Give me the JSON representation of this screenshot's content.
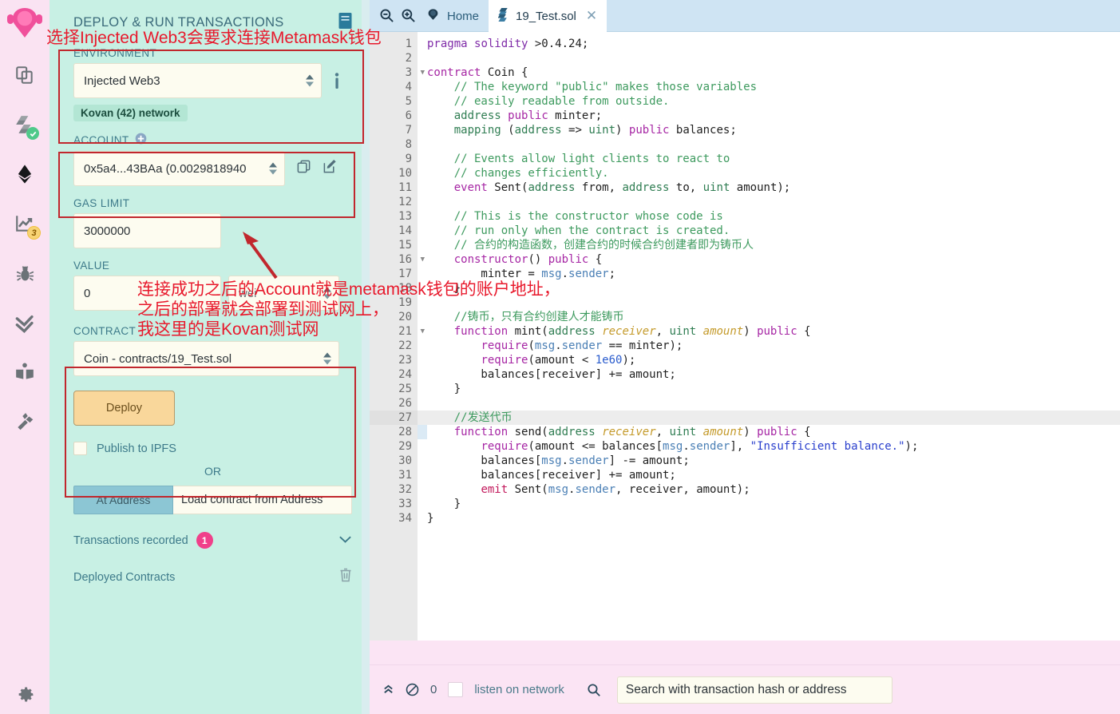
{
  "rail": {
    "logo_name": "remix-logo",
    "items": [
      {
        "name": "file-explorers",
        "icon": "files-icon",
        "badge": null
      },
      {
        "name": "solidity-compiler",
        "icon": "solidity-icon",
        "badge": "check"
      },
      {
        "name": "deploy-and-run-transactions",
        "icon": "ethereum-icon",
        "badge": null
      },
      {
        "name": "solidity-static-analysis",
        "icon": "chart-icon",
        "badge": "3"
      },
      {
        "name": "debugger",
        "icon": "bug-icon",
        "badge": null
      },
      {
        "name": "solidity-unit-testing",
        "icon": "double-check-icon",
        "badge": null
      },
      {
        "name": "remix-documentation",
        "icon": "book-icon",
        "badge": null
      },
      {
        "name": "plugin-manager",
        "icon": "plug-icon",
        "badge": null
      }
    ],
    "settings_icon": "gear-icon"
  },
  "panel": {
    "title": "DEPLOY & RUN TRANSACTIONS",
    "head_icon": "book-icon",
    "environment": {
      "label": "ENVIRONMENT",
      "value": "Injected Web3",
      "info_icon": "info-icon",
      "network_badge": "Kovan (42) network"
    },
    "account": {
      "label": "ACCOUNT",
      "add_icon": "plus-circle-icon",
      "value": "0x5a4...43BAa (0.0029818940",
      "copy_icon": "copy-icon",
      "edit_icon": "edit-icon"
    },
    "gas_limit": {
      "label": "GAS LIMIT",
      "value": "3000000"
    },
    "value_field": {
      "label": "VALUE",
      "value": "0",
      "unit": "wei"
    },
    "contract": {
      "label": "CONTRACT",
      "value": "Coin - contracts/19_Test.sol",
      "deploy_label": "Deploy"
    },
    "publish_ipfs": "Publish to IPFS",
    "or_text": "OR",
    "at_address": {
      "button": "At Address",
      "placeholder": "Load contract from Address"
    },
    "transactions_recorded": {
      "label": "Transactions recorded",
      "count": "1",
      "chevron": "chevron-down-icon"
    },
    "deployed_contracts": {
      "label": "Deployed Contracts",
      "trash_icon": "trash-icon"
    }
  },
  "editor": {
    "zoom_out_icon": "zoom-out-icon",
    "zoom_in_icon": "zoom-in-icon",
    "tabs": [
      {
        "label": "Home",
        "icon": "remix-home-icon",
        "active": false,
        "closable": false
      },
      {
        "label": "19_Test.sol",
        "icon": "solidity-file-icon",
        "active": true,
        "closable": true,
        "close_icon": "close-icon"
      }
    ],
    "total_lines": 34,
    "current_line": 27,
    "lines": [
      {
        "n": 1,
        "fold": false,
        "tokens": [
          {
            "t": "pragma",
            "c": "kb"
          },
          {
            "t": " ",
            "c": "id"
          },
          {
            "t": "solidity",
            "c": "kb"
          },
          {
            "t": " >0.4.24;",
            "c": "id"
          }
        ]
      },
      {
        "n": 2,
        "fold": false,
        "tokens": []
      },
      {
        "n": 3,
        "fold": true,
        "tokens": [
          {
            "t": "contract",
            "c": "k"
          },
          {
            "t": " Coin {",
            "c": "id"
          }
        ]
      },
      {
        "n": 4,
        "fold": false,
        "tokens": [
          {
            "t": "    // The keyword \"public\" makes those variables",
            "c": "cm"
          }
        ]
      },
      {
        "n": 5,
        "fold": false,
        "tokens": [
          {
            "t": "    // easily readable from outside.",
            "c": "cm"
          }
        ]
      },
      {
        "n": 6,
        "fold": false,
        "tokens": [
          {
            "t": "    ",
            "c": "id"
          },
          {
            "t": "address",
            "c": "ty"
          },
          {
            "t": " ",
            "c": "id"
          },
          {
            "t": "public",
            "c": "k"
          },
          {
            "t": " minter;",
            "c": "id"
          }
        ]
      },
      {
        "n": 7,
        "fold": false,
        "tokens": [
          {
            "t": "    ",
            "c": "id"
          },
          {
            "t": "mapping",
            "c": "ty"
          },
          {
            "t": " (",
            "c": "id"
          },
          {
            "t": "address",
            "c": "ty"
          },
          {
            "t": " => ",
            "c": "id"
          },
          {
            "t": "uint",
            "c": "ty"
          },
          {
            "t": ") ",
            "c": "id"
          },
          {
            "t": "public",
            "c": "k"
          },
          {
            "t": " balances;",
            "c": "id"
          }
        ]
      },
      {
        "n": 8,
        "fold": false,
        "tokens": []
      },
      {
        "n": 9,
        "fold": false,
        "tokens": [
          {
            "t": "    // Events allow light clients to react to",
            "c": "cm"
          }
        ]
      },
      {
        "n": 10,
        "fold": false,
        "tokens": [
          {
            "t": "    // changes efficiently.",
            "c": "cm"
          }
        ]
      },
      {
        "n": 11,
        "fold": false,
        "tokens": [
          {
            "t": "    ",
            "c": "id"
          },
          {
            "t": "event",
            "c": "k"
          },
          {
            "t": " Sent(",
            "c": "id"
          },
          {
            "t": "address",
            "c": "ty"
          },
          {
            "t": " from, ",
            "c": "id"
          },
          {
            "t": "address",
            "c": "ty"
          },
          {
            "t": " to, ",
            "c": "id"
          },
          {
            "t": "uint",
            "c": "ty"
          },
          {
            "t": " amount);",
            "c": "id"
          }
        ]
      },
      {
        "n": 12,
        "fold": false,
        "tokens": []
      },
      {
        "n": 13,
        "fold": false,
        "tokens": [
          {
            "t": "    // This is the constructor whose code is",
            "c": "cm"
          }
        ]
      },
      {
        "n": 14,
        "fold": false,
        "tokens": [
          {
            "t": "    // run only when the contract is created.",
            "c": "cm"
          }
        ]
      },
      {
        "n": 15,
        "fold": false,
        "tokens": [
          {
            "t": "    // 合约的构造函数，创建合约的时候合约创建者即为铸币人",
            "c": "cm"
          }
        ]
      },
      {
        "n": 16,
        "fold": true,
        "tokens": [
          {
            "t": "    ",
            "c": "id"
          },
          {
            "t": "constructor",
            "c": "k"
          },
          {
            "t": "() ",
            "c": "id"
          },
          {
            "t": "public",
            "c": "k"
          },
          {
            "t": " {",
            "c": "id"
          }
        ]
      },
      {
        "n": 17,
        "fold": false,
        "tokens": [
          {
            "t": "        minter = ",
            "c": "id"
          },
          {
            "t": "msg",
            "c": "mem"
          },
          {
            "t": ".",
            "c": "id"
          },
          {
            "t": "sender",
            "c": "mem"
          },
          {
            "t": ";",
            "c": "id"
          }
        ]
      },
      {
        "n": 18,
        "fold": false,
        "tokens": [
          {
            "t": "    }",
            "c": "id"
          }
        ]
      },
      {
        "n": 19,
        "fold": false,
        "tokens": []
      },
      {
        "n": 20,
        "fold": false,
        "tokens": [
          {
            "t": "    //铸币，只有合约创建人才能铸币",
            "c": "cm"
          }
        ]
      },
      {
        "n": 21,
        "fold": true,
        "tokens": [
          {
            "t": "    ",
            "c": "id"
          },
          {
            "t": "function",
            "c": "k"
          },
          {
            "t": " mint(",
            "c": "id"
          },
          {
            "t": "address",
            "c": "ty"
          },
          {
            "t": " ",
            "c": "id"
          },
          {
            "t": "receiver",
            "c": "par"
          },
          {
            "t": ", ",
            "c": "id"
          },
          {
            "t": "uint",
            "c": "ty"
          },
          {
            "t": " ",
            "c": "id"
          },
          {
            "t": "amount",
            "c": "par"
          },
          {
            "t": ") ",
            "c": "id"
          },
          {
            "t": "public",
            "c": "k"
          },
          {
            "t": " {",
            "c": "id"
          }
        ]
      },
      {
        "n": 22,
        "fold": false,
        "tokens": [
          {
            "t": "        ",
            "c": "id"
          },
          {
            "t": "require",
            "c": "k"
          },
          {
            "t": "(",
            "c": "id"
          },
          {
            "t": "msg",
            "c": "mem"
          },
          {
            "t": ".",
            "c": "id"
          },
          {
            "t": "sender",
            "c": "mem"
          },
          {
            "t": " == minter);",
            "c": "id"
          }
        ]
      },
      {
        "n": 23,
        "fold": false,
        "tokens": [
          {
            "t": "        ",
            "c": "id"
          },
          {
            "t": "require",
            "c": "k"
          },
          {
            "t": "(amount < ",
            "c": "id"
          },
          {
            "t": "1e60",
            "c": "num"
          },
          {
            "t": ");",
            "c": "id"
          }
        ]
      },
      {
        "n": 24,
        "fold": false,
        "tokens": [
          {
            "t": "        balances[receiver] += amount;",
            "c": "id"
          }
        ]
      },
      {
        "n": 25,
        "fold": false,
        "tokens": [
          {
            "t": "    }",
            "c": "id"
          }
        ]
      },
      {
        "n": 26,
        "fold": false,
        "tokens": []
      },
      {
        "n": 27,
        "fold": false,
        "tokens": [
          {
            "t": "    //发送代币",
            "c": "cm"
          }
        ]
      },
      {
        "n": 28,
        "fold": true,
        "tokens": [
          {
            "t": "    ",
            "c": "id"
          },
          {
            "t": "function",
            "c": "k"
          },
          {
            "t": " send(",
            "c": "id"
          },
          {
            "t": "address",
            "c": "ty"
          },
          {
            "t": " ",
            "c": "id"
          },
          {
            "t": "receiver",
            "c": "par"
          },
          {
            "t": ", ",
            "c": "id"
          },
          {
            "t": "uint",
            "c": "ty"
          },
          {
            "t": " ",
            "c": "id"
          },
          {
            "t": "amount",
            "c": "par"
          },
          {
            "t": ") ",
            "c": "id"
          },
          {
            "t": "public",
            "c": "k"
          },
          {
            "t": " {",
            "c": "id"
          }
        ]
      },
      {
        "n": 29,
        "fold": false,
        "tokens": [
          {
            "t": "        ",
            "c": "id"
          },
          {
            "t": "require",
            "c": "k"
          },
          {
            "t": "(amount <= balances[",
            "c": "id"
          },
          {
            "t": "msg",
            "c": "mem"
          },
          {
            "t": ".",
            "c": "id"
          },
          {
            "t": "sender",
            "c": "mem"
          },
          {
            "t": "], ",
            "c": "id"
          },
          {
            "t": "\"Insufficient balance.\"",
            "c": "str"
          },
          {
            "t": ");",
            "c": "id"
          }
        ]
      },
      {
        "n": 30,
        "fold": false,
        "tokens": [
          {
            "t": "        balances[",
            "c": "id"
          },
          {
            "t": "msg",
            "c": "mem"
          },
          {
            "t": ".",
            "c": "id"
          },
          {
            "t": "sender",
            "c": "mem"
          },
          {
            "t": "] -= amount;",
            "c": "id"
          }
        ]
      },
      {
        "n": 31,
        "fold": false,
        "tokens": [
          {
            "t": "        balances[receiver] += amount;",
            "c": "id"
          }
        ]
      },
      {
        "n": 32,
        "fold": false,
        "tokens": [
          {
            "t": "        ",
            "c": "id"
          },
          {
            "t": "emit",
            "c": "ev"
          },
          {
            "t": " Sent(",
            "c": "id"
          },
          {
            "t": "msg",
            "c": "mem"
          },
          {
            "t": ".",
            "c": "id"
          },
          {
            "t": "sender",
            "c": "mem"
          },
          {
            "t": ", receiver, amount);",
            "c": "id"
          }
        ]
      },
      {
        "n": 33,
        "fold": false,
        "tokens": [
          {
            "t": "    }",
            "c": "id"
          }
        ]
      },
      {
        "n": 34,
        "fold": false,
        "tokens": [
          {
            "t": "}",
            "c": "id"
          }
        ]
      }
    ]
  },
  "statusbar": {
    "collapse_icon": "chevron-up-icon",
    "clear_icon": "no-entry-icon",
    "count": "0",
    "listen_label": "listen on network",
    "search_icon": "search-icon",
    "search_placeholder": "Search with transaction hash or address"
  },
  "annotations": {
    "accent_red": "#e8192c",
    "box_red": "#c1272d",
    "top": "选择Injected Web3会要求连接Metamask钱包",
    "mid_line1": "连接成功之后的Account就是metamask钱包的账户地址，",
    "mid_line2": "之后的部署就会部署到测试网上，",
    "mid_line3": "我这里的是Kovan测试网",
    "arrow_name": "red-arrow"
  },
  "colors": {
    "rail_bg": "#fae3f2",
    "panel_bg": "#c8f0e4",
    "tabbar_bg": "#cfe4f3",
    "field_bg": "#fdfcf0",
    "deploy_btn": "#f9d79b",
    "at_address_btn": "#8cc6d4",
    "tx_badge": "#f0408a",
    "status_bg": "#fbe4f4"
  }
}
